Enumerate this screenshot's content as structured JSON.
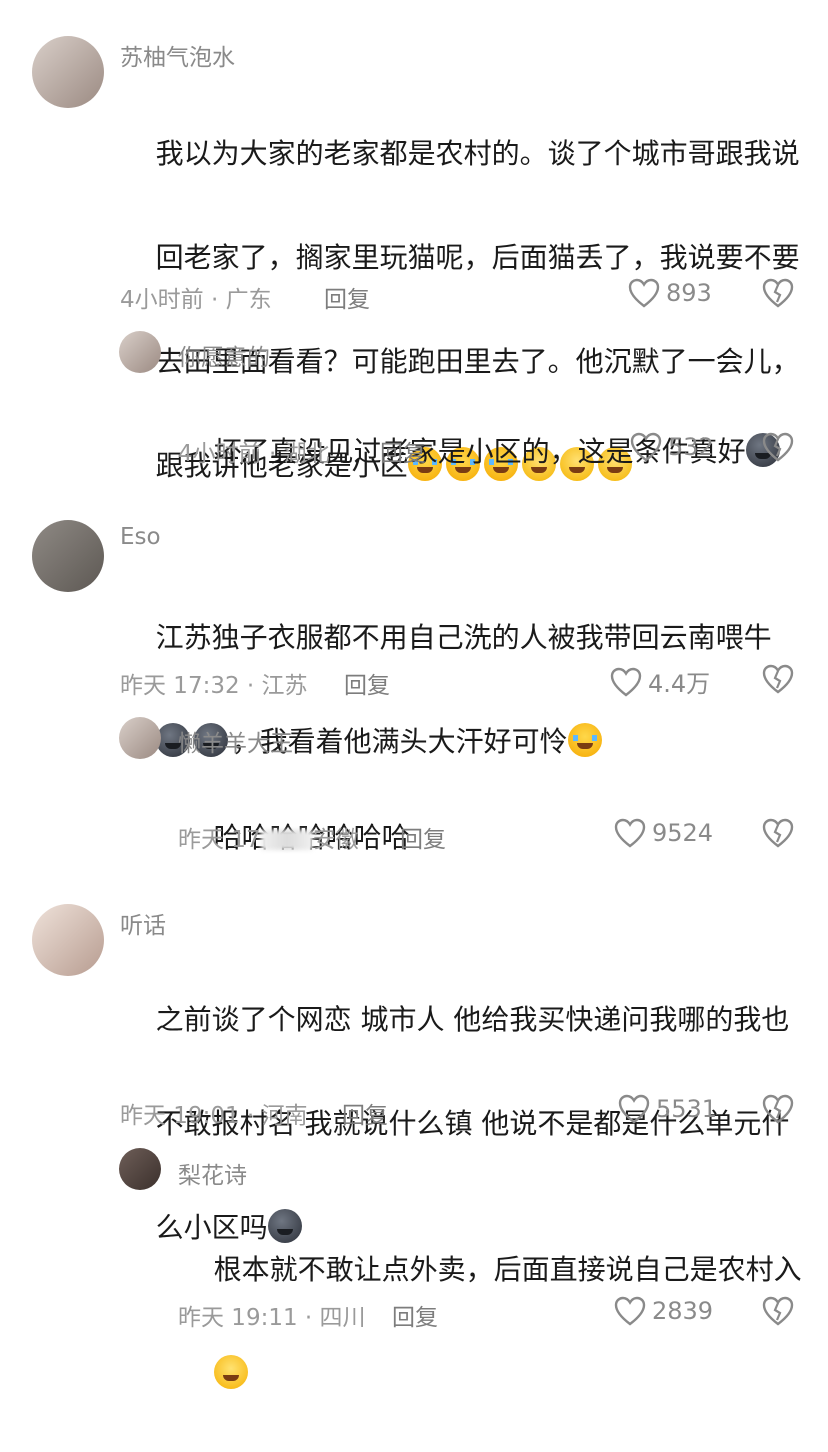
{
  "comments": [
    {
      "user": "苏柚气泡水",
      "text_lines": [
        "我以为大家的老家都是农村的。谈了个城市哥跟我说",
        "回老家了，搁家里玩猫呢，后面猫丢了，我说要不要",
        "去田里面看看？可能跑田里去了。他沉默了一会儿，",
        "跟我讲他老家是小区"
      ],
      "emojis": [
        "crying-face",
        "crying-face",
        "crying-face",
        "blushing-face",
        "blushing-face",
        "blushing-face"
      ],
      "meta": "4小时前 · 广东",
      "reply": "回复",
      "likes": "893",
      "replies": [
        {
          "user": "你愿意的",
          "text": "坏了真没见过老家是小区的，这是条件真好",
          "emojis": [
            "dark-moon-face"
          ],
          "meta": "4小时前 · 湖北",
          "reply": "回复",
          "likes": "532"
        }
      ]
    },
    {
      "user": "Eso",
      "text_lines": [
        "江苏独子衣服都不用自己洗的人被我带回云南喂牛",
        "，我看着他满头大汗好可怜"
      ],
      "emojis_prefix_line2": [
        "dark-moon-face",
        "dark-moon-face"
      ],
      "emojis": [
        "crying-face"
      ],
      "meta": "昨天 17:32 · 江苏",
      "reply": "回复",
      "likes": "4.4万",
      "replies": [
        {
          "user": "懒羊羊大王",
          "text": "哈哈哈哈哈哈哈",
          "meta_prefix": "昨天 17",
          "meta_suffix": "安徽",
          "reply": "回复",
          "likes": "9524"
        }
      ]
    },
    {
      "user": "听话",
      "text_lines": [
        "之前谈了个网恋 城市人 他给我买快递问我哪的我也",
        "不敢报村名 我就说什么镇 他说不是都是什么单元什",
        "么小区吗"
      ],
      "emojis": [
        "dark-moon-face"
      ],
      "meta": "昨天 19:01 · 河南",
      "reply": "回复",
      "likes": "5531",
      "replies": [
        {
          "user": "梨花诗",
          "text": "根本就不敢让点外卖，后面直接说自己是农村入",
          "emojis": [
            "grinning-face"
          ],
          "meta": "昨天 19:11 · 四川",
          "reply": "回复",
          "likes": "2839"
        }
      ]
    }
  ],
  "colors": {
    "text": "#1a1a1a",
    "meta": "#9a9a9a",
    "username": "#8a8a8a",
    "background": "#ffffff"
  }
}
